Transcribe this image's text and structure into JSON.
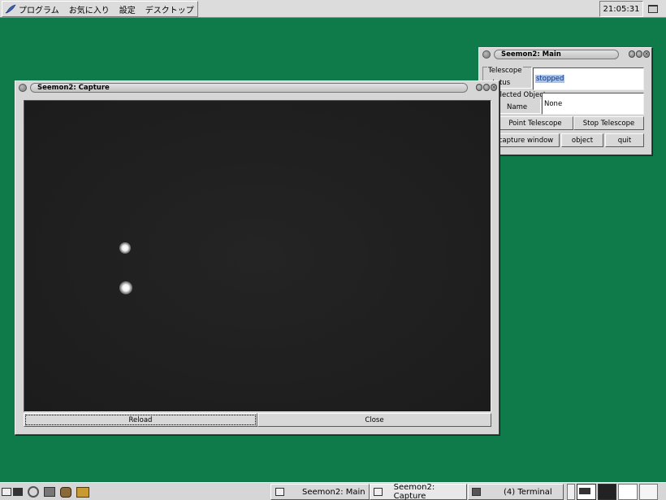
{
  "panel": {
    "menus": [
      "プログラム",
      "お気に入り",
      "設定",
      "デスクトップ"
    ],
    "clock": "21:05:31"
  },
  "capture_window": {
    "title": "Seemon2: Capture",
    "buttons": {
      "reload": "Reload",
      "close": "Close"
    }
  },
  "main_window": {
    "title": "Seemon2: Main",
    "telescope": {
      "legend": "Telescope",
      "status_label": "status",
      "status_value": "stopped"
    },
    "selected_object": {
      "legend": "Selected Object",
      "name_label": "Name",
      "name_value": "None"
    },
    "buttons": {
      "point_telescope": "Point Telescope",
      "stop_telescope": "Stop Telescope",
      "capture_window": "capture window",
      "object": "object",
      "quit": "quit"
    }
  },
  "taskbar": {
    "tasks": [
      {
        "label": "Seemon2: Main"
      },
      {
        "label": "Seemon2: Capture"
      },
      {
        "label": "(4) Terminal"
      }
    ]
  },
  "colors": {
    "desktop": "#0f7a4a",
    "chrome": "#d6d6d6",
    "selection": "#a8c4e8"
  }
}
